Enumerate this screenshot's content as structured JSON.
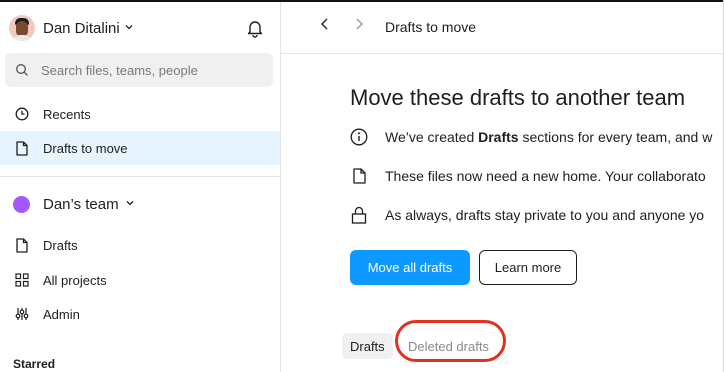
{
  "user": {
    "name": "Dan Ditalini"
  },
  "search": {
    "placeholder": "Search files, teams, people"
  },
  "nav": {
    "recents": "Recents",
    "drafts_to_move": "Drafts to move"
  },
  "team": {
    "name": "Dan’s team",
    "color": "#a259ff",
    "items": {
      "drafts": "Drafts",
      "all_projects": "All projects",
      "admin": "Admin"
    }
  },
  "starred": {
    "title": "Starred"
  },
  "topbar": {
    "breadcrumb": "Drafts to move"
  },
  "main": {
    "title": "Move these drafts to another team",
    "info": [
      {
        "icon": "info-icon",
        "prefix": "We’ve created ",
        "bold": "Drafts",
        "suffix": " sections for every team, and w"
      },
      {
        "icon": "file-icon",
        "text": "These files now need a new home. Your collaborato"
      },
      {
        "icon": "lock-icon",
        "text": "As always, drafts stay private to you and anyone yo"
      }
    ],
    "primary_button": "Move all drafts",
    "secondary_button": "Learn more",
    "tabs": [
      {
        "label": "Drafts",
        "active": true
      },
      {
        "label": "Deleted drafts",
        "active": false,
        "annotated": true
      }
    ]
  },
  "colors": {
    "accent": "#0d99ff",
    "active_bg": "#e5f4ff",
    "annotation": "#e0321e"
  }
}
